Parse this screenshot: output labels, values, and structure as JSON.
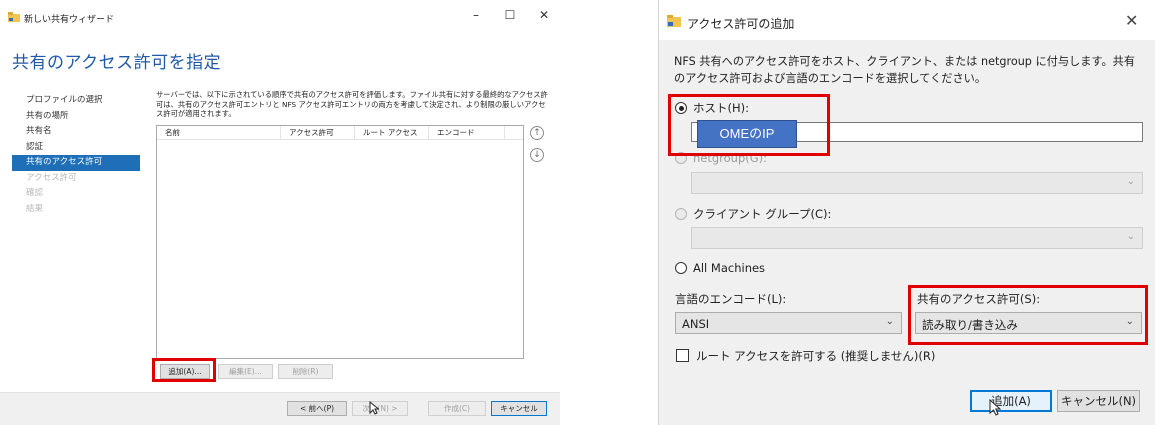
{
  "wizard": {
    "title": "新しい共有ウィザード",
    "window_controls": {
      "minimize": "–",
      "maximize": "☐",
      "close": "✕"
    },
    "heading": "共有のアクセス許可を指定",
    "nav": [
      {
        "label": "プロファイルの選択",
        "state": "normal"
      },
      {
        "label": "共有の場所",
        "state": "normal"
      },
      {
        "label": "共有名",
        "state": "normal"
      },
      {
        "label": "認証",
        "state": "normal"
      },
      {
        "label": "共有のアクセス許可",
        "state": "active"
      },
      {
        "label": "アクセス許可",
        "state": "disabled"
      },
      {
        "label": "確認",
        "state": "disabled"
      },
      {
        "label": "結果",
        "state": "disabled"
      }
    ],
    "description": "サーバーでは、以下に示されている順序で共有のアクセス許可を評価します。ファイル共有に対する最終的なアクセス許可は、共有のアクセス許可エントリと NFS アクセス許可エントリの両方を考慮して決定され、より制限の厳しいアクセス許可が適用されます。",
    "table_columns": [
      "名前",
      "アクセス許可",
      "ルート アクセス",
      "エンコード"
    ],
    "add_button": "追加(A)...",
    "edit_button": "編集(E)...",
    "delete_button": "削除(R)",
    "prev_button": "< 前へ(P)",
    "next_button": "次へ(N) >",
    "create_button": "作成(C)",
    "cancel_button": "キャンセル"
  },
  "dialog": {
    "title": "アクセス許可の追加",
    "close": "✕",
    "description": "NFS 共有へのアクセス許可をホスト、クライアント、または netgroup に付与します。共有のアクセス許可および言語のエンコードを選択してください。",
    "host_label": "ホスト(H):",
    "host_value": "",
    "netgroup_label": "netgroup(G):",
    "client_group_label": "クライアント グループ(C):",
    "all_machines_label": "All Machines",
    "encoding_label": "言語のエンコード(L):",
    "encoding_value": "ANSI",
    "share_permission_label": "共有のアクセス許可(S):",
    "share_permission_value": "読み取り/書き込み",
    "root_access_label": "ルート アクセスを許可する (推奨しません)(R)",
    "root_access_checked": false,
    "add_button": "追加(A)",
    "cancel_button": "キャンセル(N)"
  },
  "annotation": {
    "ome_ip_label": "OMEのIP",
    "highlight_color": "#e00000",
    "label_color": "#4472c4"
  }
}
